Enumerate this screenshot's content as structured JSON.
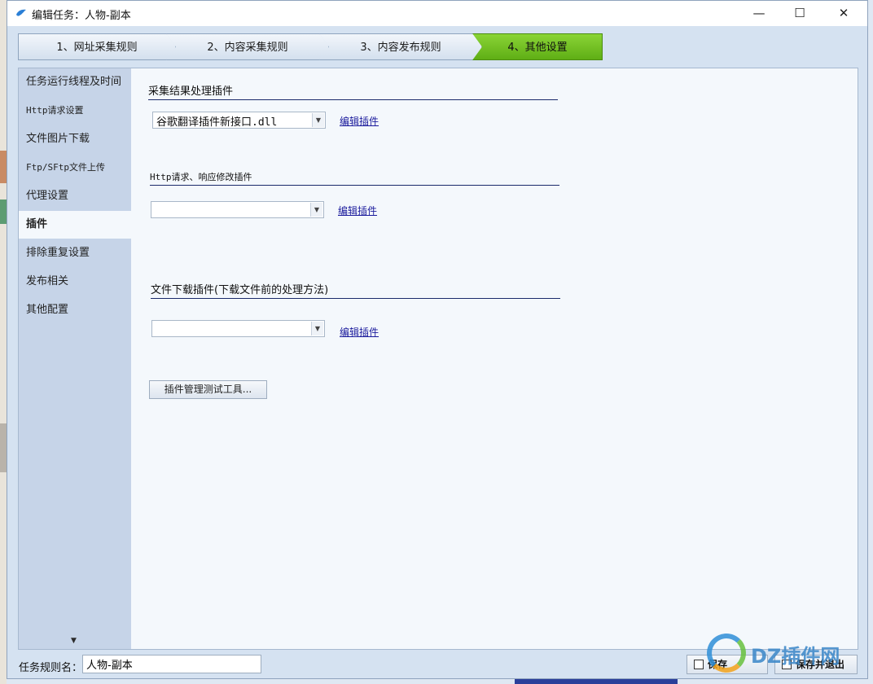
{
  "window": {
    "title": "编辑任务：人物-副本",
    "controls": {
      "minimize": "—",
      "maximize": "☐",
      "close": "✕"
    }
  },
  "steps": [
    {
      "label": "1、网址采集规则",
      "active": false
    },
    {
      "label": "2、内容采集规则",
      "active": false
    },
    {
      "label": "3、内容发布规则",
      "active": false
    },
    {
      "label": "4、其他设置",
      "active": true
    }
  ],
  "sidebar": {
    "items": [
      {
        "label": "任务运行线程及时间"
      },
      {
        "label": "Http请求设置"
      },
      {
        "label": "文件图片下载"
      },
      {
        "label": "Ftp/SFtp文件上传"
      },
      {
        "label": "代理设置"
      },
      {
        "label": "插件",
        "active": true
      },
      {
        "label": "排除重复设置"
      },
      {
        "label": "发布相关"
      },
      {
        "label": "其他配置"
      }
    ],
    "scroll_indicator": "▼"
  },
  "plugins": {
    "result_group": {
      "title": "采集结果处理插件",
      "selected": "谷歌翻译插件新接口.dll",
      "edit_link": "编辑插件"
    },
    "http_group": {
      "title": "Http请求、响应修改插件",
      "selected": "",
      "edit_link": "编辑插件"
    },
    "download_group": {
      "title": "文件下载插件(下载文件前的处理方法)",
      "selected": "",
      "edit_link": "编辑插件"
    },
    "tool_button": "插件管理测试工具..."
  },
  "bottom": {
    "rule_name_label": "任务规则名：",
    "rule_name_value": "人物-副本",
    "save_button": "保存",
    "save_exit_button": "保存并退出"
  },
  "watermark": {
    "text": "DZ插件网"
  },
  "colors": {
    "active_step": "#6cbf1e",
    "sidebar_bg": "#c6d4e8",
    "link": "#1a1a9c"
  }
}
